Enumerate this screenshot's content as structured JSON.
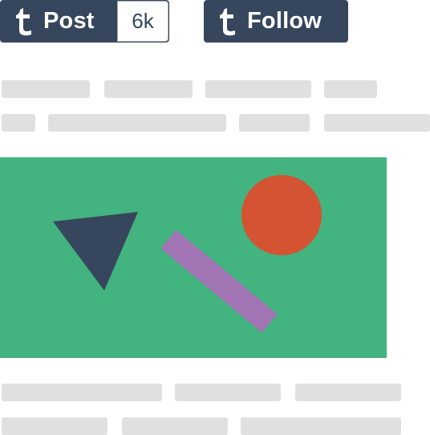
{
  "buttons": {
    "post": {
      "label": "Post",
      "count": "6k"
    },
    "follow": {
      "label": "Follow"
    }
  },
  "colors": {
    "button_bg": "#36465d",
    "placeholder": "#e0e0e0",
    "image_bg": "#43b37f",
    "circle": "#d45332",
    "triangle": "#36465d",
    "bar_shape": "#a174b3"
  },
  "icons": {
    "post_logo": "tumblr-t-icon",
    "follow_logo": "tumblr-t-icon"
  }
}
